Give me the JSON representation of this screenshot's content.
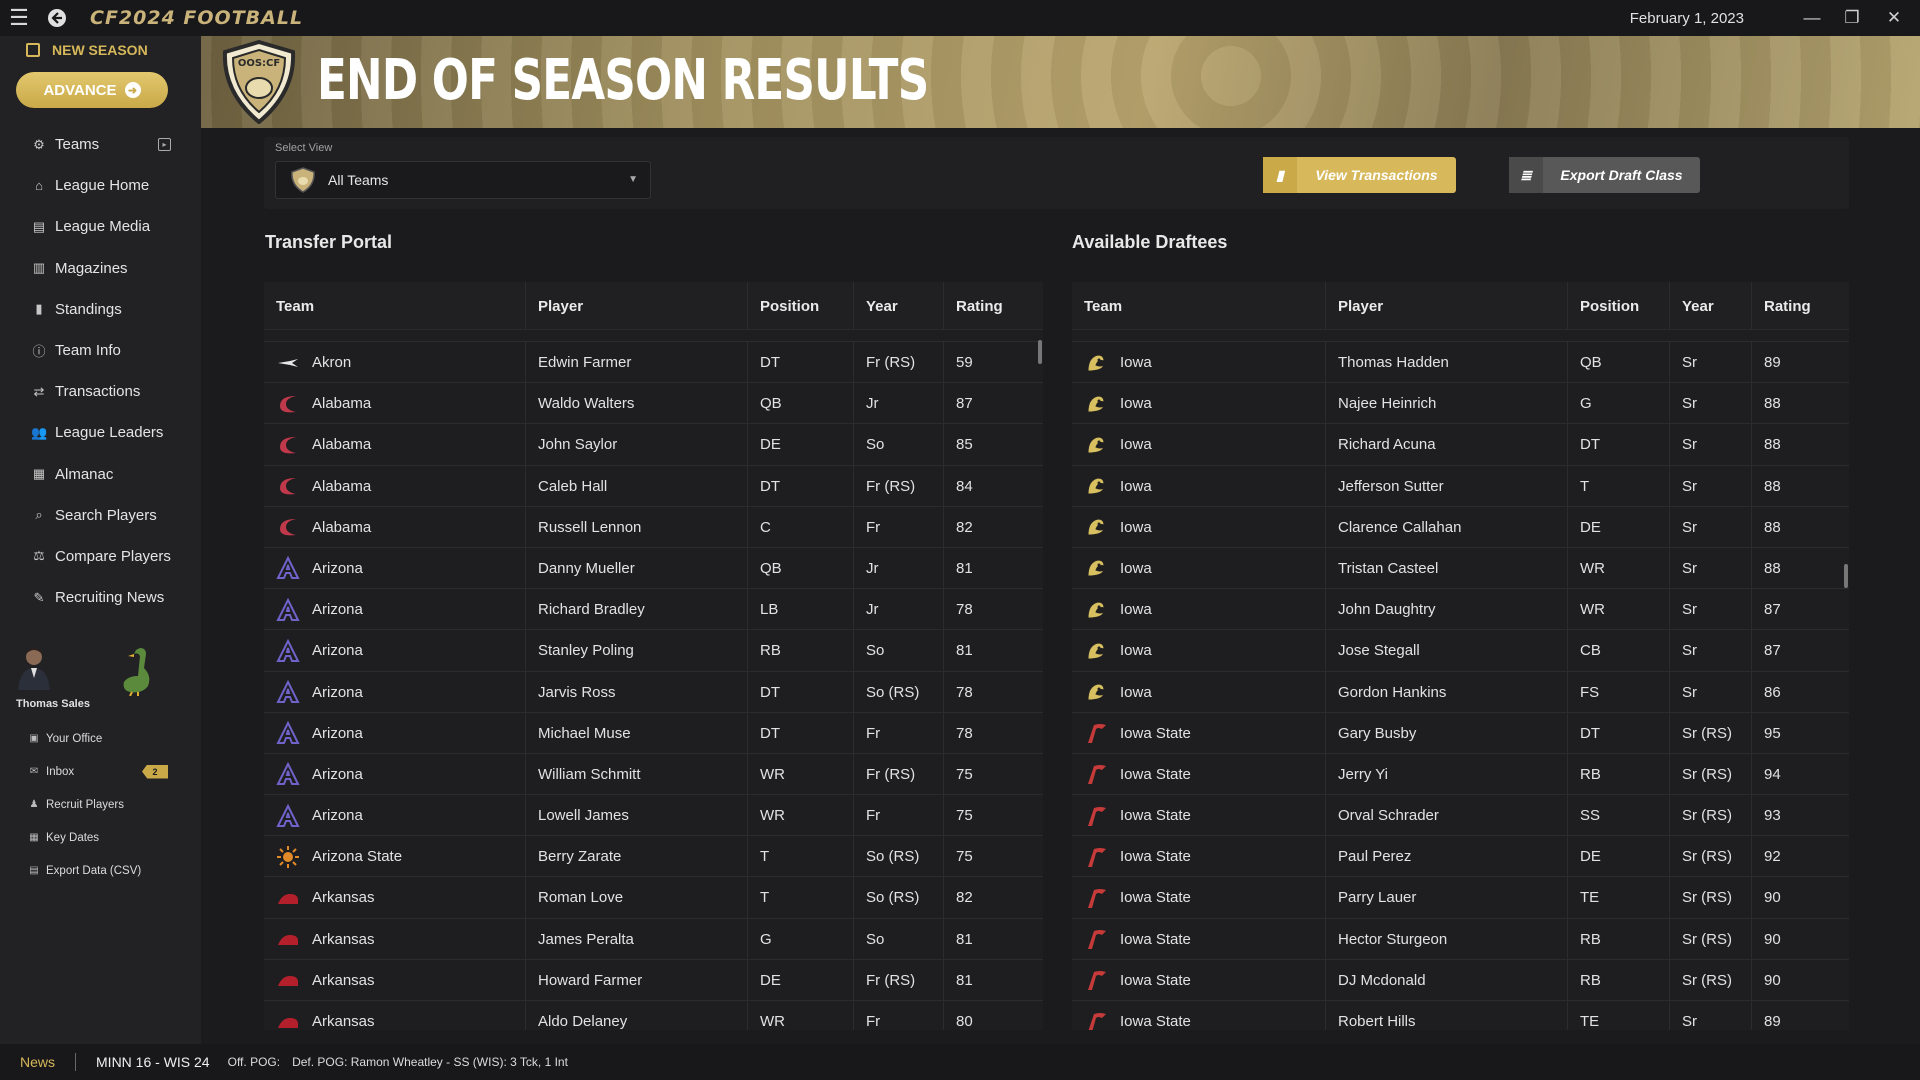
{
  "app": {
    "logo_text": "CF2024 FOOTBALL",
    "date": "February 1, 2023"
  },
  "sidebar": {
    "new_season": "NEW SEASON",
    "advance": "ADVANCE",
    "items": [
      {
        "label": "Teams",
        "icon": "teams-icon"
      },
      {
        "label": "League Home",
        "icon": "home-icon"
      },
      {
        "label": "League Media",
        "icon": "media-icon"
      },
      {
        "label": "Magazines",
        "icon": "book-icon"
      },
      {
        "label": "Standings",
        "icon": "bar-chart-icon"
      },
      {
        "label": "Team Info",
        "icon": "info-icon"
      },
      {
        "label": "Transactions",
        "icon": "transactions-icon"
      },
      {
        "label": "League Leaders",
        "icon": "users-icon"
      },
      {
        "label": "Almanac",
        "icon": "almanac-icon"
      },
      {
        "label": "Search Players",
        "icon": "search-icon"
      },
      {
        "label": "Compare Players",
        "icon": "scale-icon"
      },
      {
        "label": "Recruiting News",
        "icon": "news-icon"
      }
    ],
    "coach_name": "Thomas Sales",
    "sub_items": [
      {
        "label": "Your Office",
        "icon": "briefcase-icon"
      },
      {
        "label": "Inbox",
        "icon": "mail-icon",
        "badge": "2"
      },
      {
        "label": "Recruit Players",
        "icon": "recruit-icon"
      },
      {
        "label": "Key Dates",
        "icon": "calendar-icon"
      },
      {
        "label": "Export Data (CSV)",
        "icon": "export-icon"
      }
    ]
  },
  "header": {
    "crest_text": "OOS:CF",
    "title": "END OF SEASON RESULTS"
  },
  "toolbar": {
    "select_label": "Select View",
    "select_value": "All Teams",
    "view_transactions": "View Transactions",
    "export_draft_class": "Export Draft Class"
  },
  "transfer_portal": {
    "title": "Transfer Portal",
    "columns": [
      "Team",
      "Player",
      "Position",
      "Year",
      "Rating"
    ],
    "rows": [
      [
        "Akron",
        "Edwin Farmer",
        "DT",
        "Fr (RS)",
        "59"
      ],
      [
        "Alabama",
        "Waldo Walters",
        "QB",
        "Jr",
        "87"
      ],
      [
        "Alabama",
        "John Saylor",
        "DE",
        "So",
        "85"
      ],
      [
        "Alabama",
        "Caleb Hall",
        "DT",
        "Fr (RS)",
        "84"
      ],
      [
        "Alabama",
        "Russell Lennon",
        "C",
        "Fr",
        "82"
      ],
      [
        "Arizona",
        "Danny Mueller",
        "QB",
        "Jr",
        "81"
      ],
      [
        "Arizona",
        "Richard Bradley",
        "LB",
        "Jr",
        "78"
      ],
      [
        "Arizona",
        "Stanley Poling",
        "RB",
        "So",
        "81"
      ],
      [
        "Arizona",
        "Jarvis Ross",
        "DT",
        "So (RS)",
        "78"
      ],
      [
        "Arizona",
        "Michael Muse",
        "DT",
        "Fr",
        "78"
      ],
      [
        "Arizona",
        "William Schmitt",
        "WR",
        "Fr (RS)",
        "75"
      ],
      [
        "Arizona",
        "Lowell James",
        "WR",
        "Fr",
        "75"
      ],
      [
        "Arizona State",
        "Berry Zarate",
        "T",
        "So (RS)",
        "75"
      ],
      [
        "Arkansas",
        "Roman Love",
        "T",
        "So (RS)",
        "82"
      ],
      [
        "Arkansas",
        "James Peralta",
        "G",
        "So",
        "81"
      ],
      [
        "Arkansas",
        "Howard Farmer",
        "DE",
        "Fr (RS)",
        "81"
      ],
      [
        "Arkansas",
        "Aldo Delaney",
        "WR",
        "Fr",
        "80"
      ]
    ]
  },
  "draftees": {
    "title": "Available Draftees",
    "columns": [
      "Team",
      "Player",
      "Position",
      "Year",
      "Rating"
    ],
    "rows": [
      [
        "Iowa",
        "Thomas Hadden",
        "QB",
        "Sr",
        "89"
      ],
      [
        "Iowa",
        "Najee Heinrich",
        "G",
        "Sr",
        "88"
      ],
      [
        "Iowa",
        "Richard Acuna",
        "DT",
        "Sr",
        "88"
      ],
      [
        "Iowa",
        "Jefferson Sutter",
        "T",
        "Sr",
        "88"
      ],
      [
        "Iowa",
        "Clarence Callahan",
        "DE",
        "Sr",
        "88"
      ],
      [
        "Iowa",
        "Tristan Casteel",
        "WR",
        "Sr",
        "88"
      ],
      [
        "Iowa",
        "John Daughtry",
        "WR",
        "Sr",
        "87"
      ],
      [
        "Iowa",
        "Jose Stegall",
        "CB",
        "Sr",
        "87"
      ],
      [
        "Iowa",
        "Gordon Hankins",
        "FS",
        "Sr",
        "86"
      ],
      [
        "Iowa State",
        "Gary Busby",
        "DT",
        "Sr (RS)",
        "95"
      ],
      [
        "Iowa State",
        "Jerry Yi",
        "RB",
        "Sr (RS)",
        "94"
      ],
      [
        "Iowa State",
        "Orval Schrader",
        "SS",
        "Sr (RS)",
        "93"
      ],
      [
        "Iowa State",
        "Paul Perez",
        "DE",
        "Sr (RS)",
        "92"
      ],
      [
        "Iowa State",
        "Parry Lauer",
        "TE",
        "Sr (RS)",
        "90"
      ],
      [
        "Iowa State",
        "Hector Sturgeon",
        "RB",
        "Sr (RS)",
        "90"
      ],
      [
        "Iowa State",
        "DJ Mcdonald",
        "RB",
        "Sr (RS)",
        "90"
      ],
      [
        "Iowa State",
        "Robert Hills",
        "TE",
        "Sr",
        "89"
      ]
    ]
  },
  "team_colors": {
    "Akron": "#e6e6e6",
    "Alabama": "#c0394b",
    "Arizona": "#6f62c9",
    "Arizona State": "#e08a2a",
    "Arkansas": "#b3202c",
    "Iowa": "#d8c060",
    "Iowa State": "#c73a3a"
  },
  "ticker": {
    "label": "News",
    "score": "MINN 16 - WIS 24",
    "off_pog": "Off. POG:",
    "def_pog": "Def. POG: Ramon Wheatley - SS (WIS): 3 Tck, 1 Int"
  }
}
